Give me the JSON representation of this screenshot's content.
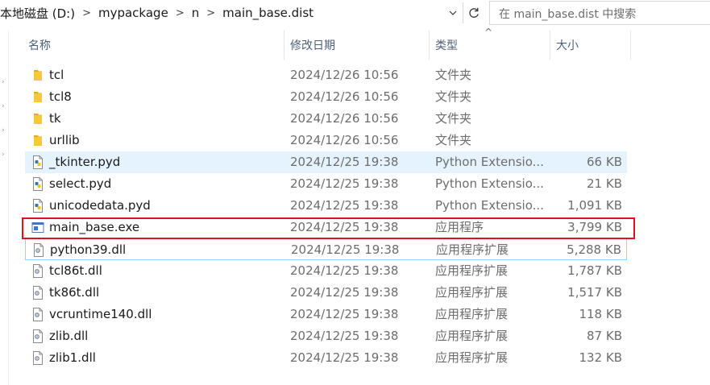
{
  "breadcrumb": [
    "本地磁盘 (D:)",
    "mypackage",
    "n",
    "main_base.dist"
  ],
  "search": {
    "placeholder": "在 main_base.dist 中搜索"
  },
  "columns": {
    "name": "名称",
    "date": "修改日期",
    "type": "类型",
    "size": "大小"
  },
  "files": [
    {
      "name": "tcl",
      "date": "2024/12/26 10:56",
      "type": "文件夹",
      "size": "",
      "icon": "folder-icon"
    },
    {
      "name": "tcl8",
      "date": "2024/12/26 10:56",
      "type": "文件夹",
      "size": "",
      "icon": "folder-icon"
    },
    {
      "name": "tk",
      "date": "2024/12/26 10:56",
      "type": "文件夹",
      "size": "",
      "icon": "folder-icon"
    },
    {
      "name": "urllib",
      "date": "2024/12/26 10:56",
      "type": "文件夹",
      "size": "",
      "icon": "folder-icon"
    },
    {
      "name": "_tkinter.pyd",
      "date": "2024/12/25 19:38",
      "type": "Python Extensio...",
      "size": "66 KB",
      "icon": "python-file-icon"
    },
    {
      "name": "select.pyd",
      "date": "2024/12/25 19:38",
      "type": "Python Extensio...",
      "size": "21 KB",
      "icon": "python-file-icon"
    },
    {
      "name": "unicodedata.pyd",
      "date": "2024/12/25 19:38",
      "type": "Python Extensio...",
      "size": "1,091 KB",
      "icon": "python-file-icon"
    },
    {
      "name": "main_base.exe",
      "date": "2024/12/25 19:38",
      "type": "应用程序",
      "size": "3,799 KB",
      "icon": "exe-file-icon"
    },
    {
      "name": "python39.dll",
      "date": "2024/12/25 19:38",
      "type": "应用程序扩展",
      "size": "5,288 KB",
      "icon": "dll-file-icon"
    },
    {
      "name": "tcl86t.dll",
      "date": "2024/12/25 19:38",
      "type": "应用程序扩展",
      "size": "1,787 KB",
      "icon": "dll-file-icon"
    },
    {
      "name": "tk86t.dll",
      "date": "2024/12/25 19:38",
      "type": "应用程序扩展",
      "size": "1,517 KB",
      "icon": "dll-file-icon"
    },
    {
      "name": "vcruntime140.dll",
      "date": "2024/12/25 19:38",
      "type": "应用程序扩展",
      "size": "118 KB",
      "icon": "dll-file-icon"
    },
    {
      "name": "zlib.dll",
      "date": "2024/12/25 19:38",
      "type": "应用程序扩展",
      "size": "87 KB",
      "icon": "dll-file-icon"
    },
    {
      "name": "zlib1.dll",
      "date": "2024/12/25 19:38",
      "type": "应用程序扩展",
      "size": "132 KB",
      "icon": "dll-file-icon"
    }
  ],
  "colors": {
    "highlight": "#d9131f",
    "hover": "#e5f3ff",
    "folder": "#f8c839",
    "header_text": "#4c607a"
  }
}
